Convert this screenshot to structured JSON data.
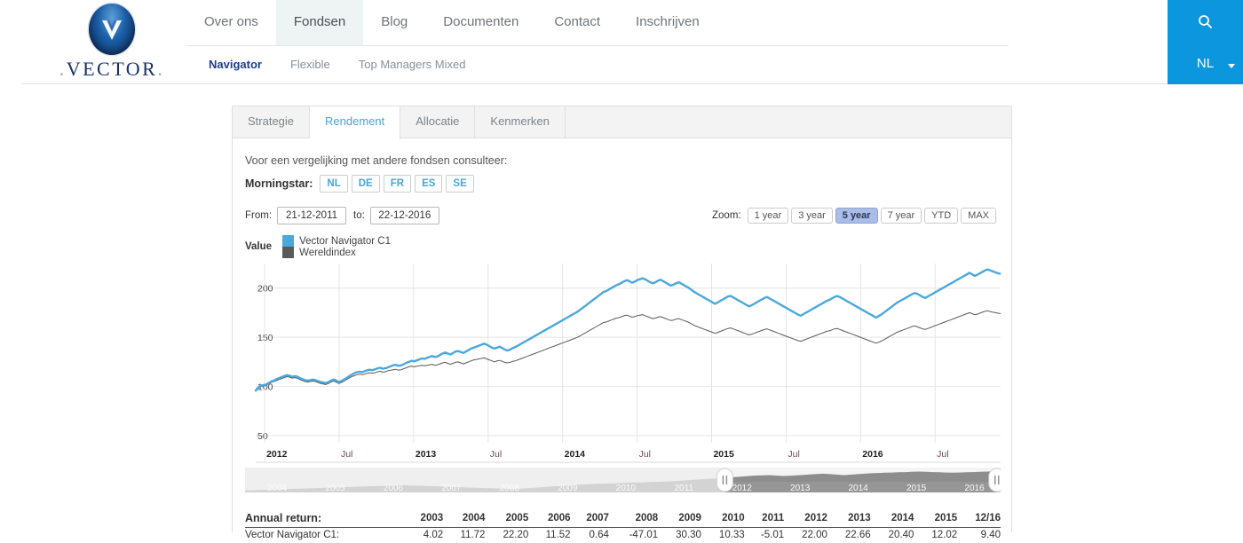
{
  "header": {
    "logo": {
      "wordmark": "VECTOR",
      "emblem_letter": "V",
      "emblem_color": "#1c5fa8"
    },
    "nav": [
      {
        "label": "Over ons",
        "active": false
      },
      {
        "label": "Fondsen",
        "active": true
      },
      {
        "label": "Blog",
        "active": false
      },
      {
        "label": "Documenten",
        "active": false
      },
      {
        "label": "Contact",
        "active": false
      },
      {
        "label": "Inschrijven",
        "active": false
      }
    ],
    "subnav": [
      {
        "label": "Navigator",
        "active": true
      },
      {
        "label": "Flexible",
        "active": false
      },
      {
        "label": "Top Managers Mixed",
        "active": false
      }
    ],
    "utility": {
      "search_icon": "search-icon",
      "language": "NL",
      "accent_color": "#0c96de"
    }
  },
  "panel": {
    "tabs": [
      {
        "label": "Strategie",
        "active": false
      },
      {
        "label": "Rendement",
        "active": true
      },
      {
        "label": "Allocatie",
        "active": false
      },
      {
        "label": "Kenmerken",
        "active": false
      }
    ],
    "intro_text": "Voor een vergelijking met andere fondsen consulteer:",
    "morningstar_label": "Morningstar:",
    "morningstar_buttons": [
      "NL",
      "DE",
      "FR",
      "ES",
      "SE"
    ],
    "date_from_label": "From:",
    "date_from_value": "21-12-2011",
    "date_to_label": "to:",
    "date_to_value": "22-12-2016",
    "zoom_label": "Zoom:",
    "zoom_buttons": [
      {
        "label": "1 year",
        "active": false
      },
      {
        "label": "3 year",
        "active": false
      },
      {
        "label": "5 year",
        "active": true
      },
      {
        "label": "7 year",
        "active": false
      },
      {
        "label": "YTD",
        "active": false
      },
      {
        "label": "MAX",
        "active": false
      }
    ],
    "legend_title": "Value"
  },
  "chart_data": {
    "type": "line",
    "title": "",
    "xlabel": "",
    "ylabel": "Value",
    "ylim": [
      50,
      225
    ],
    "yticks": [
      50,
      100,
      150,
      200
    ],
    "grid": true,
    "legend_position": "top-left",
    "xtick_labels": [
      "2012",
      "Jul",
      "2013",
      "Jul",
      "2014",
      "Jul",
      "2015",
      "Jul",
      "2016",
      "Jul"
    ],
    "series": [
      {
        "name": "Vector Navigator C1",
        "color": "#4aa8dd",
        "width": 2.4,
        "values": [
          96,
          99,
          101,
          101.5,
          102,
          103.5,
          105,
          106,
          107.5,
          108.5,
          109.5,
          110.5,
          111.5,
          111,
          110,
          110.5,
          110,
          108.5,
          107.5,
          106.5,
          106,
          106.5,
          107,
          106.5,
          105.5,
          104.5,
          104,
          103.5,
          104.5,
          106,
          107,
          106,
          104.5,
          105.5,
          107,
          108.5,
          110.5,
          112,
          113.5,
          114.5,
          115,
          114.5,
          115.5,
          116.5,
          117,
          116.5,
          117.5,
          118.5,
          119,
          118,
          118.5,
          119.5,
          120.5,
          121.5,
          122,
          121,
          121.5,
          122.5,
          124,
          125,
          126,
          125.5,
          126.5,
          127.5,
          128.5,
          128,
          129,
          130,
          131,
          130,
          130.5,
          132,
          133.5,
          134.5,
          133.5,
          132.5,
          134,
          135.5,
          136,
          135,
          134,
          135.5,
          137,
          138.5,
          139.5,
          140.5,
          141.5,
          142.5,
          143.5,
          142.5,
          141,
          139.5,
          138.5,
          139.5,
          140.5,
          139,
          137.5,
          136.5,
          137.5,
          139,
          140,
          141.5,
          143,
          144.5,
          146,
          147.5,
          149,
          150.5,
          152,
          153.5,
          155,
          156.5,
          158,
          159.5,
          161,
          162.5,
          164,
          165.5,
          167,
          168.5,
          170,
          171.5,
          173,
          174.5,
          176,
          178,
          180,
          182,
          184,
          186,
          188,
          190,
          192,
          194,
          196,
          197,
          198.5,
          200,
          201.5,
          203,
          204,
          205.5,
          207,
          208,
          207,
          205.5,
          206.5,
          208,
          209,
          210,
          209,
          207.5,
          206,
          205,
          206,
          207.5,
          208.5,
          207,
          205.5,
          204,
          202.5,
          203.5,
          205,
          206,
          204.5,
          203,
          201.5,
          200,
          198,
          196,
          194.5,
          193,
          191.5,
          190,
          188.5,
          187,
          185.5,
          184,
          185.5,
          187,
          188.5,
          190,
          191.5,
          192,
          190.5,
          189,
          187.5,
          186,
          184.5,
          183,
          181.5,
          182.5,
          184,
          185.5,
          187,
          188.5,
          190,
          191,
          189.5,
          188,
          186.5,
          185,
          183.5,
          182,
          180.5,
          179,
          177.5,
          176,
          174.5,
          173,
          172,
          173.5,
          175,
          176.5,
          178,
          179.5,
          181,
          182.5,
          184,
          185.5,
          187,
          188,
          189.5,
          191,
          192,
          191,
          189.5,
          188,
          186.5,
          185,
          183.5,
          182,
          180.5,
          179,
          177.5,
          176,
          174.5,
          173,
          171.5,
          170,
          171.5,
          173,
          175,
          177,
          179,
          181,
          183,
          185,
          186.5,
          188,
          189.5,
          191,
          192.5,
          194,
          195,
          194,
          192.5,
          191,
          190,
          191.5,
          193,
          194.5,
          196,
          197.5,
          199,
          200.5,
          202,
          203.5,
          205,
          206.5,
          208,
          209.5,
          211,
          212.5,
          214,
          215.5,
          214,
          212.5,
          213.5,
          215,
          216.5,
          218,
          219,
          218,
          217,
          216,
          215,
          214.5
        ]
      },
      {
        "name": "Wereldindex",
        "color": "#5a5a5a",
        "width": 1,
        "values": [
          95,
          98,
          100,
          100.5,
          101,
          102.5,
          104,
          105,
          106,
          107,
          108,
          109,
          110,
          109.5,
          108.5,
          109,
          108.5,
          107,
          106,
          105,
          104.5,
          105,
          105.5,
          105,
          104,
          103,
          102.5,
          102,
          103,
          104.5,
          105.5,
          104.5,
          103,
          104,
          105.5,
          107,
          108.5,
          110,
          111,
          112,
          112.5,
          112,
          112.5,
          113.5,
          114,
          113.5,
          114,
          115,
          115.5,
          114.5,
          115,
          116,
          116.5,
          117,
          117.5,
          116.5,
          117,
          118,
          119,
          120,
          120.5,
          120,
          120.5,
          121,
          121.5,
          121,
          121.5,
          122,
          122.5,
          121.5,
          122,
          123,
          124,
          124.5,
          123.5,
          122.5,
          123.5,
          124.5,
          125,
          124,
          123,
          124,
          125,
          126,
          127,
          127.5,
          128,
          128.5,
          129,
          128,
          127,
          126,
          125,
          126,
          126.5,
          125.5,
          124.5,
          124,
          124.5,
          125.5,
          126,
          127,
          128,
          129,
          130,
          131,
          132,
          133,
          134,
          135,
          136,
          137,
          138,
          139,
          140,
          141,
          142,
          143,
          144,
          145,
          146,
          147,
          148,
          149,
          150,
          151.5,
          153,
          154.5,
          156,
          157.5,
          159,
          160.5,
          162,
          163.5,
          165,
          165.5,
          166.5,
          167.5,
          168.5,
          169.5,
          170,
          171,
          172,
          172.5,
          171.5,
          170.5,
          171,
          172,
          172.5,
          173,
          172,
          171,
          170,
          169,
          169.5,
          170.5,
          171,
          170,
          169,
          168,
          167,
          167.5,
          168.5,
          169,
          168,
          167,
          166,
          165,
          163.5,
          162,
          161,
          160,
          159,
          158,
          157,
          156,
          155,
          154,
          155,
          156,
          157,
          158,
          159,
          159.5,
          158.5,
          157.5,
          156.5,
          155.5,
          154.5,
          153.5,
          152.5,
          153,
          154,
          155,
          156,
          157,
          158,
          158.5,
          157.5,
          156.5,
          155.5,
          154.5,
          153.5,
          152.5,
          151.5,
          150.5,
          149.5,
          148.5,
          147.5,
          146.5,
          146,
          147,
          148,
          149,
          150,
          151,
          152,
          153,
          154,
          155,
          156,
          156.5,
          157.5,
          158.5,
          159,
          158,
          157,
          156,
          155,
          154,
          153,
          152,
          151,
          150,
          149,
          148,
          147,
          146,
          145,
          144,
          145,
          146,
          147.5,
          149,
          150.5,
          152,
          153.5,
          155,
          156,
          157,
          158,
          159,
          160,
          161,
          161.5,
          160.5,
          159.5,
          158.5,
          158,
          159,
          160,
          161,
          162,
          163,
          164,
          165,
          166,
          167,
          168,
          169,
          170,
          171,
          172,
          173,
          174,
          175,
          174,
          173,
          173.5,
          174.5,
          175.5,
          176.5,
          177,
          176,
          175.5,
          175,
          174.5,
          174
        ]
      }
    ]
  },
  "navigator": {
    "years": [
      "2004",
      "2005",
      "2006",
      "2007",
      "2008",
      "2009",
      "2010",
      "2011",
      "2012",
      "2013",
      "2014",
      "2015",
      "2016"
    ],
    "selected_from": "2012",
    "selected_to": "2016",
    "handle_left_pct": 63.5,
    "handle_right_pct": 99.5,
    "series_values": [
      8,
      9,
      10,
      11,
      12,
      13,
      14,
      15,
      16,
      17,
      18,
      19,
      20,
      21,
      22,
      23,
      24,
      25,
      26,
      27,
      28,
      29,
      30,
      31,
      30,
      29,
      28,
      27,
      26,
      25,
      24,
      23,
      22,
      21,
      20,
      19,
      18,
      17,
      16,
      15,
      16,
      17,
      19,
      21,
      23,
      25,
      27,
      29,
      31,
      33,
      35,
      36,
      37,
      38,
      39,
      40,
      41,
      42,
      43,
      44,
      45,
      46,
      47,
      48,
      50,
      52,
      54,
      56,
      58,
      60,
      62,
      64,
      66,
      68,
      70,
      72,
      73,
      74,
      72,
      70,
      71,
      73,
      75,
      77,
      79,
      80,
      78,
      76,
      74,
      76,
      78,
      80,
      82,
      83,
      84,
      85,
      86,
      87,
      88,
      89,
      88,
      87,
      86,
      85,
      84,
      85,
      86,
      87,
      88,
      89,
      90,
      91
    ]
  },
  "annual_return": {
    "label": "Annual return:",
    "years": [
      "2003",
      "2004",
      "2005",
      "2006",
      "2007",
      "2008",
      "2009",
      "2010",
      "2011",
      "2012",
      "2013",
      "2014",
      "2015",
      "12/16"
    ],
    "rows": [
      {
        "name": "Vector Navigator C1:",
        "values": [
          "4.02",
          "11.72",
          "22.20",
          "11.52",
          "0.64",
          "-47.01",
          "30.30",
          "10.33",
          "-5.01",
          "22.00",
          "22.66",
          "20.40",
          "12.02",
          "9.40"
        ]
      }
    ]
  }
}
